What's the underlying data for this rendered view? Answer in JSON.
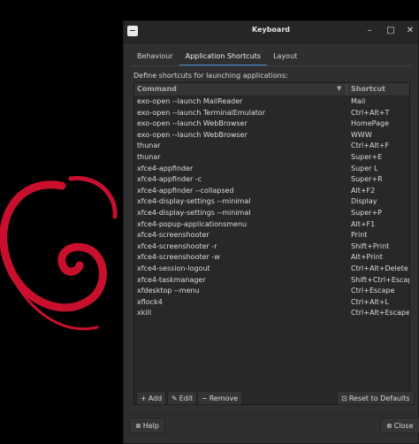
{
  "window": {
    "title": "Keyboard",
    "controls": [
      "–",
      "□",
      "✕"
    ]
  },
  "tabs": [
    {
      "label": "Behaviour"
    },
    {
      "label": "Application Shortcuts"
    },
    {
      "label": "Layout"
    }
  ],
  "description": "Define shortcuts for launching applications:",
  "table": {
    "headers": {
      "command": "Command",
      "shortcut": "Shortcut"
    },
    "rows": [
      {
        "command": "exo-open --launch MailReader",
        "shortcut": "Mail"
      },
      {
        "command": "exo-open --launch TerminalEmulator",
        "shortcut": "Ctrl+Alt+T"
      },
      {
        "command": "exo-open --launch WebBrowser",
        "shortcut": "HomePage"
      },
      {
        "command": "exo-open --launch WebBrowser",
        "shortcut": "WWW"
      },
      {
        "command": "thunar",
        "shortcut": "Ctrl+Alt+F"
      },
      {
        "command": "thunar",
        "shortcut": "Super+E"
      },
      {
        "command": "xfce4-appfinder",
        "shortcut": "Super L"
      },
      {
        "command": "xfce4-appfinder -c",
        "shortcut": "Super+R"
      },
      {
        "command": "xfce4-appfinder --collapsed",
        "shortcut": "Alt+F2"
      },
      {
        "command": "xfce4-display-settings --minimal",
        "shortcut": "Display"
      },
      {
        "command": "xfce4-display-settings --minimal",
        "shortcut": "Super+P"
      },
      {
        "command": "xfce4-popup-applicationsmenu",
        "shortcut": "Alt+F1"
      },
      {
        "command": "xfce4-screenshooter",
        "shortcut": "Print"
      },
      {
        "command": "xfce4-screenshooter -r",
        "shortcut": "Shift+Print"
      },
      {
        "command": "xfce4-screenshooter -w",
        "shortcut": "Alt+Print"
      },
      {
        "command": "xfce4-session-logout",
        "shortcut": "Ctrl+Alt+Delete"
      },
      {
        "command": "xfce4-taskmanager",
        "shortcut": "Shift+Ctrl+Escape"
      },
      {
        "command": "xfdesktop --menu",
        "shortcut": "Ctrl+Escape"
      },
      {
        "command": "xflock4",
        "shortcut": "Ctrl+Alt+L"
      },
      {
        "command": "xkill",
        "shortcut": "Ctrl+Alt+Escape"
      }
    ]
  },
  "toolbar": {
    "add_label": "Add",
    "edit_label": "Edit",
    "remove_label": "Remove",
    "reset_label": "Reset to Defaults"
  },
  "footer": {
    "help_label": "Help",
    "close_label": "Close"
  },
  "colors": {
    "accent": "#4a90d9",
    "debian_red": "#c8102e"
  }
}
